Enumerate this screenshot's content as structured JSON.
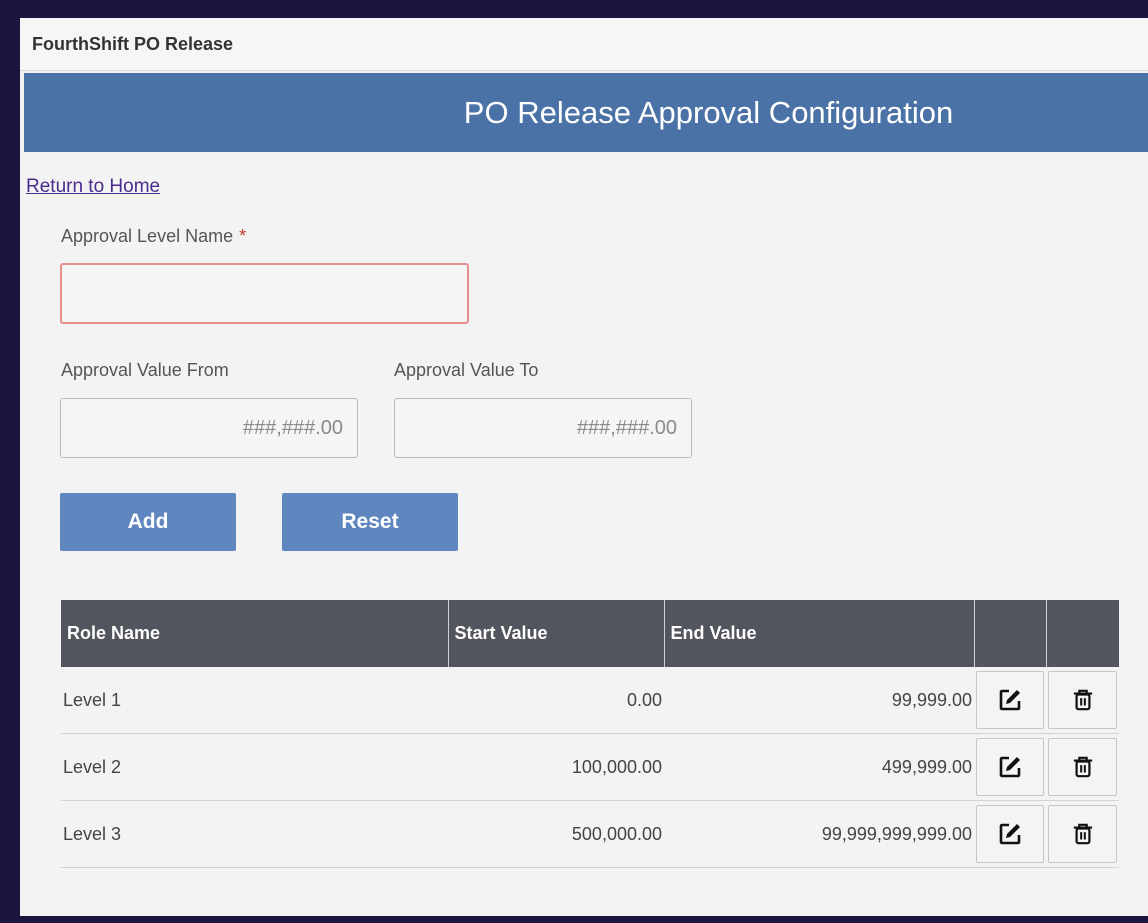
{
  "window": {
    "title": "FourthShift PO Release"
  },
  "banner": {
    "title": "PO Release Approval Configuration"
  },
  "nav": {
    "return_home": "Return to Home"
  },
  "form": {
    "level_name": {
      "label": "Approval Level Name",
      "required_mark": "*",
      "value": ""
    },
    "value_from": {
      "label": "Approval Value From",
      "placeholder": "###,###.00"
    },
    "value_to": {
      "label": "Approval Value To",
      "placeholder": "###,###.00"
    },
    "add_label": "Add",
    "reset_label": "Reset"
  },
  "table": {
    "columns": [
      "Role Name",
      "Start Value",
      "End Value",
      "",
      ""
    ],
    "rows": [
      {
        "role": "Level 1",
        "start": "0.00",
        "end": "99,999.00"
      },
      {
        "role": "Level 2",
        "start": "100,000.00",
        "end": "499,999.00"
      },
      {
        "role": "Level 3",
        "start": "500,000.00",
        "end": "99,999,999,999.00"
      }
    ],
    "row_actions": [
      "edit-icon",
      "trash-icon"
    ]
  },
  "colors": {
    "banner": "#4b72a6",
    "button": "#5f86bf",
    "table_header": "#52555d",
    "required": "#c0392b",
    "frame_background": "#1b1540"
  }
}
